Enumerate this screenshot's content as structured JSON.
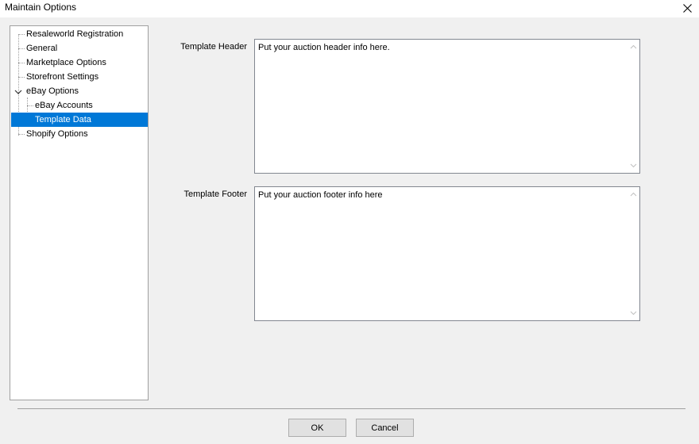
{
  "window": {
    "title": "Maintain Options"
  },
  "tree": {
    "items": [
      {
        "label": "Resaleworld Registration"
      },
      {
        "label": "General"
      },
      {
        "label": "Marketplace Options"
      },
      {
        "label": "Storefront Settings"
      },
      {
        "label": "eBay Options",
        "expanded": true
      },
      {
        "label": "eBay Accounts"
      },
      {
        "label": "Template Data",
        "selected": true
      },
      {
        "label": "Shopify Options"
      }
    ]
  },
  "form": {
    "header_label": "Template Header",
    "header_value": "Put your auction header info here.",
    "footer_label": "Template Footer",
    "footer_value": "Put your auction footer info here"
  },
  "buttons": {
    "ok": "OK",
    "cancel": "Cancel"
  },
  "colors": {
    "selection": "#0078d7",
    "dialog_bg": "#f0f0f0"
  }
}
